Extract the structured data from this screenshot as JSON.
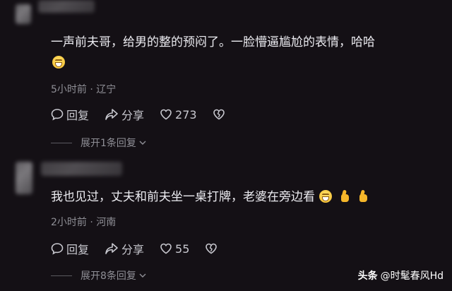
{
  "comments": [
    {
      "text": "一声前夫哥，给男的整的预闷了。一脸懵逼尴尬的表情，哈哈",
      "emoji": "grin-emoji",
      "meta": "5小时前 · 辽宁",
      "reply_label": "回复",
      "share_label": "分享",
      "likes": "273",
      "expand": "展开1条回复"
    },
    {
      "text": "我也见过，丈夫和前夫坐一桌打牌，老婆在旁边看",
      "emoji": "grin-emoji",
      "meta": "2小时前 · 河南",
      "reply_label": "回复",
      "share_label": "分享",
      "likes": "55",
      "expand": "展开8条回复"
    }
  ],
  "watermark": {
    "brand": "头条",
    "handle": "@时髦春风Hd"
  },
  "colors": {
    "background": "#141015",
    "text": "#ececf1",
    "muted": "#8f8f96",
    "emoji": "#f5b62a"
  }
}
